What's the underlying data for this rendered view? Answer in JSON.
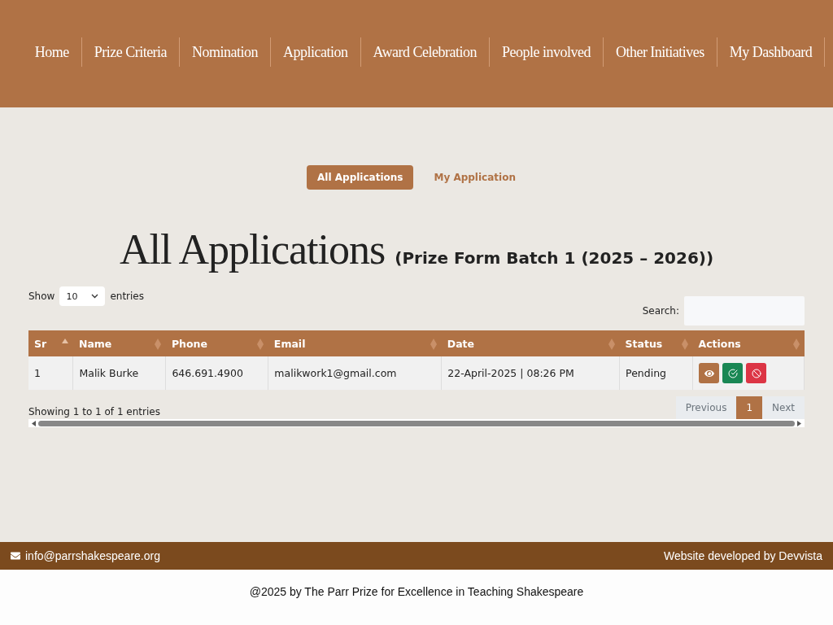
{
  "nav": [
    {
      "label": "Home"
    },
    {
      "label": "Prize Criteria"
    },
    {
      "label": "Nomination"
    },
    {
      "label": "Application"
    },
    {
      "label": "Award Celebration"
    },
    {
      "label": "People involved"
    },
    {
      "label": "Other Initiatives"
    },
    {
      "label": "My Dashboard"
    }
  ],
  "tabs": [
    {
      "label": "All Applications",
      "selected": true
    },
    {
      "label": "My Application",
      "selected": false
    }
  ],
  "heading": {
    "title": "All Applications",
    "subtitle": "(Prize Form Batch 1 (2025 – 2026))"
  },
  "length": {
    "before": "Show",
    "value": "10",
    "after": "entries"
  },
  "search": {
    "label": "Search:"
  },
  "table": {
    "columns": [
      {
        "label": "Sr",
        "sorted": true
      },
      {
        "label": "Name",
        "sorted": false
      },
      {
        "label": "Phone",
        "sorted": false
      },
      {
        "label": "Email",
        "sorted": false
      },
      {
        "label": "Date",
        "sorted": false
      },
      {
        "label": "Status",
        "sorted": false
      },
      {
        "label": "Actions",
        "sorted": false
      }
    ],
    "rows": [
      {
        "cells": [
          "1",
          "Malik Burke",
          "646.691.4900",
          "malikwork1@gmail.com",
          "22-April-2025 | 08:26 PM",
          "Pending"
        ],
        "actions": [
          {
            "kind": "view"
          },
          {
            "kind": "approve"
          },
          {
            "kind": "reject"
          }
        ]
      }
    ]
  },
  "info": "Showing 1 to 1 of 1 entries",
  "pagination": [
    {
      "label": "Previous",
      "disabled": true,
      "selected": false
    },
    {
      "label": "1",
      "disabled": false,
      "selected": true
    },
    {
      "label": "Next",
      "disabled": true,
      "selected": false
    }
  ],
  "footer": {
    "email": "info@parrshakespeare.org",
    "credit": "Website developed by Devvista",
    "copyright": "@2025 by The Parr Prize for Excellence in Teaching Shakespeare"
  }
}
